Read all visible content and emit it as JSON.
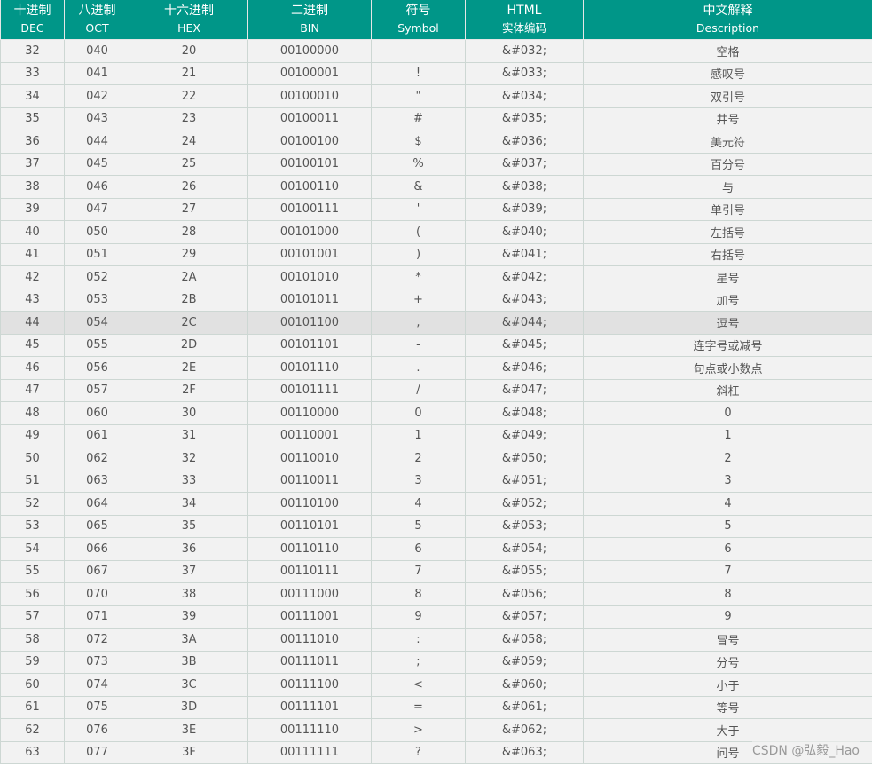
{
  "headers": [
    {
      "zh": "十进制",
      "en": "DEC"
    },
    {
      "zh": "八进制",
      "en": "OCT"
    },
    {
      "zh": "十六进制",
      "en": "HEX"
    },
    {
      "zh": "二进制",
      "en": "BIN"
    },
    {
      "zh": "符号",
      "en": "Symbol"
    },
    {
      "zh": "HTML",
      "en": "实体编码"
    },
    {
      "zh": "中文解释",
      "en": "Description"
    }
  ],
  "highlight_row": 12,
  "rows": [
    [
      "32",
      "040",
      "20",
      "00100000",
      "",
      "&#032;",
      "空格"
    ],
    [
      "33",
      "041",
      "21",
      "00100001",
      "!",
      "&#033;",
      "感叹号"
    ],
    [
      "34",
      "042",
      "22",
      "00100010",
      "\"",
      "&#034;",
      "双引号"
    ],
    [
      "35",
      "043",
      "23",
      "00100011",
      "#",
      "&#035;",
      "井号"
    ],
    [
      "36",
      "044",
      "24",
      "00100100",
      "$",
      "&#036;",
      "美元符"
    ],
    [
      "37",
      "045",
      "25",
      "00100101",
      "%",
      "&#037;",
      "百分号"
    ],
    [
      "38",
      "046",
      "26",
      "00100110",
      "&",
      "&#038;",
      "与"
    ],
    [
      "39",
      "047",
      "27",
      "00100111",
      "'",
      "&#039;",
      "单引号"
    ],
    [
      "40",
      "050",
      "28",
      "00101000",
      "(",
      "&#040;",
      "左括号"
    ],
    [
      "41",
      "051",
      "29",
      "00101001",
      ")",
      "&#041;",
      "右括号"
    ],
    [
      "42",
      "052",
      "2A",
      "00101010",
      "*",
      "&#042;",
      "星号"
    ],
    [
      "43",
      "053",
      "2B",
      "00101011",
      "+",
      "&#043;",
      "加号"
    ],
    [
      "44",
      "054",
      "2C",
      "00101100",
      ",",
      "&#044;",
      "逗号"
    ],
    [
      "45",
      "055",
      "2D",
      "00101101",
      "-",
      "&#045;",
      "连字号或减号"
    ],
    [
      "46",
      "056",
      "2E",
      "00101110",
      ".",
      "&#046;",
      "句点或小数点"
    ],
    [
      "47",
      "057",
      "2F",
      "00101111",
      "/",
      "&#047;",
      "斜杠"
    ],
    [
      "48",
      "060",
      "30",
      "00110000",
      "0",
      "&#048;",
      "0"
    ],
    [
      "49",
      "061",
      "31",
      "00110001",
      "1",
      "&#049;",
      "1"
    ],
    [
      "50",
      "062",
      "32",
      "00110010",
      "2",
      "&#050;",
      "2"
    ],
    [
      "51",
      "063",
      "33",
      "00110011",
      "3",
      "&#051;",
      "3"
    ],
    [
      "52",
      "064",
      "34",
      "00110100",
      "4",
      "&#052;",
      "4"
    ],
    [
      "53",
      "065",
      "35",
      "00110101",
      "5",
      "&#053;",
      "5"
    ],
    [
      "54",
      "066",
      "36",
      "00110110",
      "6",
      "&#054;",
      "6"
    ],
    [
      "55",
      "067",
      "37",
      "00110111",
      "7",
      "&#055;",
      "7"
    ],
    [
      "56",
      "070",
      "38",
      "00111000",
      "8",
      "&#056;",
      "8"
    ],
    [
      "57",
      "071",
      "39",
      "00111001",
      "9",
      "&#057;",
      "9"
    ],
    [
      "58",
      "072",
      "3A",
      "00111010",
      ":",
      "&#058;",
      "冒号"
    ],
    [
      "59",
      "073",
      "3B",
      "00111011",
      ";",
      "&#059;",
      "分号"
    ],
    [
      "60",
      "074",
      "3C",
      "00111100",
      "<",
      "&#060;",
      "小于"
    ],
    [
      "61",
      "075",
      "3D",
      "00111101",
      "=",
      "&#061;",
      "等号"
    ],
    [
      "62",
      "076",
      "3E",
      "00111110",
      ">",
      "&#062;",
      "大于"
    ],
    [
      "63",
      "077",
      "3F",
      "00111111",
      "?",
      "&#063;",
      "问号"
    ]
  ],
  "watermark": "CSDN @弘毅_Hao",
  "colors": {
    "header_bg": "#009688",
    "row_bg": "#f2f2f2",
    "highlight_bg": "#e1e1e1"
  }
}
